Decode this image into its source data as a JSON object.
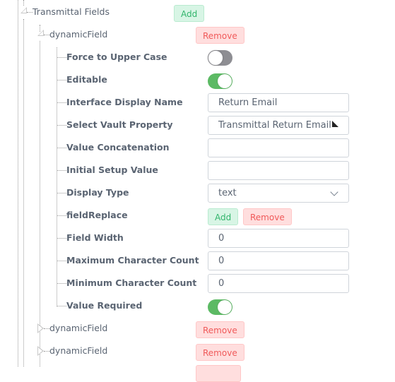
{
  "tree": {
    "root": {
      "label": "Transmittal Fields",
      "expanded": true,
      "add_label": "Add"
    },
    "dynamic_field_expanded": {
      "label": "dynamicField",
      "expanded": true,
      "remove_label": "Remove",
      "properties": {
        "force_upper": {
          "label": "Force to Upper Case",
          "value": false
        },
        "editable": {
          "label": "Editable",
          "value": true
        },
        "interface_display_name": {
          "label": "Interface Display Name",
          "value": "Return Email"
        },
        "select_vault_property": {
          "label": "Select Vault Property",
          "value": "Transmittal Return Email"
        },
        "value_concatenation": {
          "label": "Value Concatenation",
          "value": ""
        },
        "initial_setup_value": {
          "label": "Initial Setup Value",
          "value": ""
        },
        "display_type": {
          "label": "Display Type",
          "value": "text"
        },
        "field_replace": {
          "label": "fieldReplace",
          "add_label": "Add",
          "remove_label": "Remove"
        },
        "field_width": {
          "label": "Field Width",
          "value": "0"
        },
        "max_char_count": {
          "label": "Maximum Character Count",
          "value": "0"
        },
        "min_char_count": {
          "label": "Minimum Character Count",
          "value": "0"
        },
        "value_required": {
          "label": "Value Required",
          "value": true
        }
      }
    },
    "collapsed_fields": [
      {
        "label": "dynamicField",
        "remove_label": "Remove"
      },
      {
        "label": "dynamicField",
        "remove_label": "Remove"
      }
    ]
  },
  "colors": {
    "add_bg": "#d8f5e5",
    "add_text": "#32b56c",
    "remove_bg": "#ffdede",
    "remove_text": "#f05a5a",
    "toggle_on": "#5cba64",
    "toggle_off": "#8e8e93"
  }
}
